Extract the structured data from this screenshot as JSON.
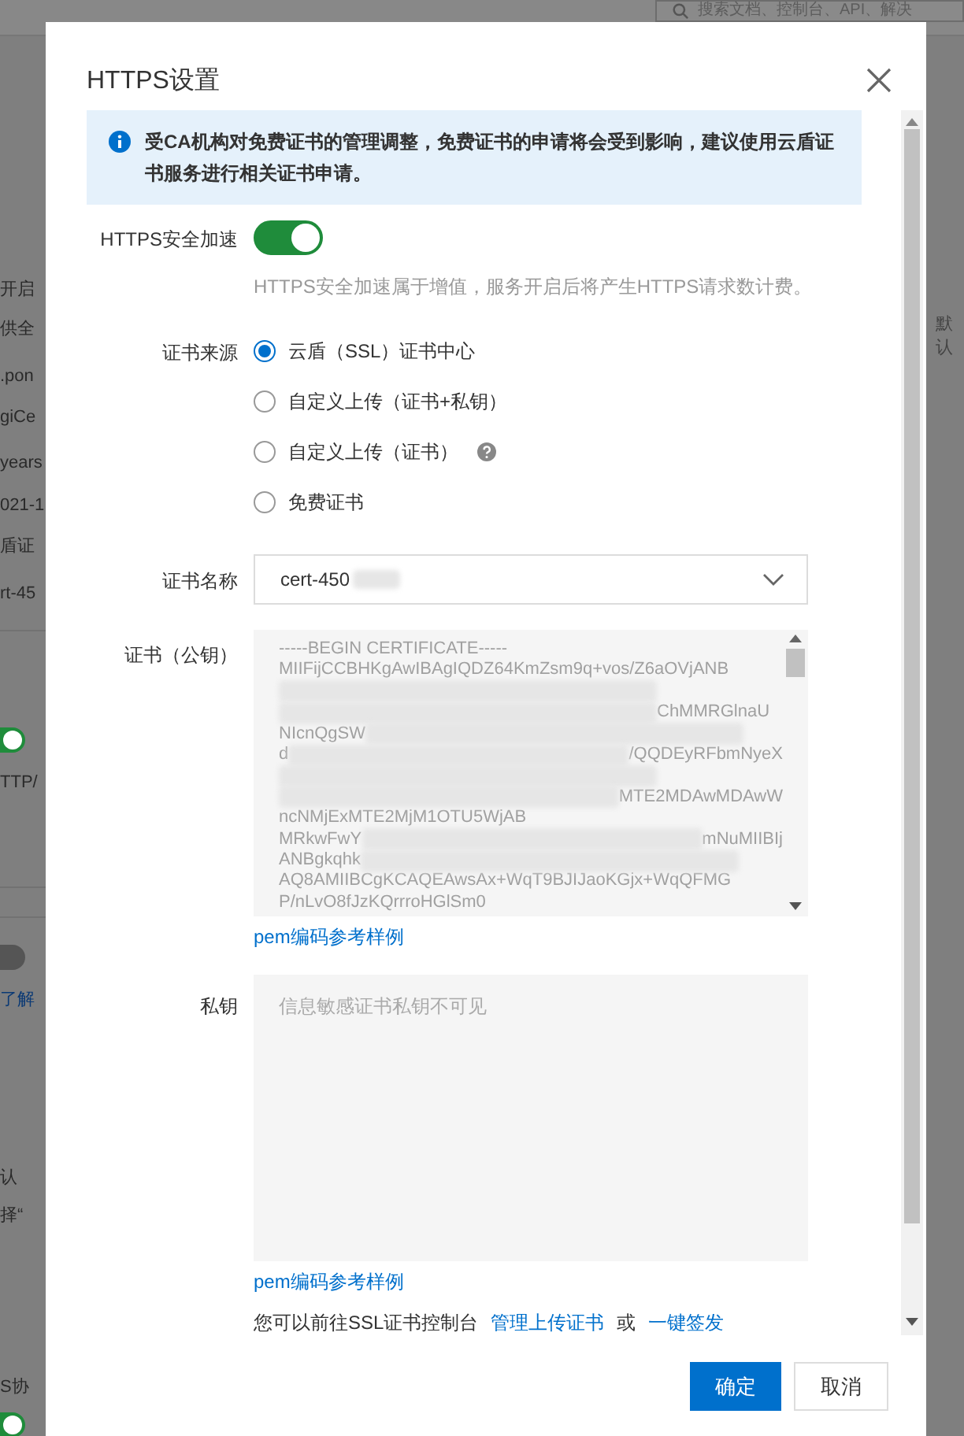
{
  "background": {
    "search": {
      "placeholder": "搜索文档、控制台、API、解决"
    },
    "left_fragments": [
      {
        "kind": "text",
        "text": "开启"
      },
      {
        "kind": "text",
        "text": "供全"
      },
      {
        "kind": "text",
        "text": ".pon"
      },
      {
        "kind": "text",
        "text": "giCe"
      },
      {
        "kind": "text",
        "text": "years"
      },
      {
        "kind": "text",
        "text": "021-1"
      },
      {
        "kind": "text",
        "text": "盾证"
      },
      {
        "kind": "text",
        "text": "rt-45"
      },
      {
        "kind": "switch",
        "on": true
      },
      {
        "kind": "text",
        "text": "TTP/"
      },
      {
        "kind": "switch",
        "on": false
      },
      {
        "kind": "link",
        "text": "了解"
      },
      {
        "kind": "text",
        "text": "认"
      },
      {
        "kind": "text",
        "text": "择“"
      },
      {
        "kind": "text",
        "text": "S协"
      },
      {
        "kind": "switch",
        "on": true
      }
    ],
    "right_fragments": [
      {
        "text": "默认"
      }
    ]
  },
  "dialog": {
    "title": "HTTPS设置",
    "notice": "受CA机构对免费证书的管理调整，免费证书的申请将会受到影响，建议使用云盾证书服务进行相关证书申请。",
    "https_acceleration": {
      "label": "HTTPS安全加速",
      "on": true,
      "hint": "HTTPS安全加速属于增值，服务开启后将产生HTTPS请求数计费。"
    },
    "cert_source": {
      "label": "证书来源",
      "options": [
        {
          "label": "云盾（SSL）证书中心",
          "selected": true,
          "help": false
        },
        {
          "label": "自定义上传（证书+私钥）",
          "selected": false,
          "help": false
        },
        {
          "label": "自定义上传（证书）",
          "selected": false,
          "help": true
        },
        {
          "label": "免费证书",
          "selected": false,
          "help": false
        }
      ]
    },
    "cert_name": {
      "label": "证书名称",
      "value": "cert-450"
    },
    "public_key": {
      "label": "证书（公钥）",
      "link": "pem编码参考样例",
      "lines": [
        [
          {
            "kind": "text",
            "text": "-----BEGIN CERTIFICATE-----"
          }
        ],
        [
          {
            "kind": "text",
            "text": "MIIFijCCBHKgAwIBAgIQDZ64KmZsm9q+vos/Z6aOVjANB"
          }
        ],
        [
          {
            "kind": "blur"
          }
        ],
        [
          {
            "kind": "blur"
          },
          {
            "kind": "text",
            "text": "ChMMRGlnaU"
          }
        ],
        [
          {
            "kind": "text",
            "text": "NIcnQgSW"
          },
          {
            "kind": "blur"
          }
        ],
        [
          {
            "kind": "text",
            "text": "d"
          },
          {
            "kind": "blur"
          },
          {
            "kind": "text",
            "text": "/QQDEyRFbmNyeX"
          }
        ],
        [
          {
            "kind": "blur"
          }
        ],
        [
          {
            "kind": "blur"
          },
          {
            "kind": "text",
            "text": "MTE2MDAwMDAwW"
          }
        ],
        [
          {
            "kind": "text",
            "text": "ncNMjExMTE2MjM1OTU5WjAB"
          }
        ],
        [
          {
            "kind": "text",
            "text": "MRkwFwY"
          },
          {
            "kind": "blur"
          },
          {
            "kind": "text",
            "text": "mNuMIIBIj"
          }
        ],
        [
          {
            "kind": "text",
            "text": "ANBgkqhk"
          },
          {
            "kind": "blur"
          }
        ],
        [
          {
            "kind": "text",
            "text": "AQ8AMIIBCgKCAQEAwsAx+WqT9BJIJaoKGjx+WqQFMG"
          }
        ],
        [
          {
            "kind": "text",
            "text": "P/nLvO8fJzKQrrroHGlSm0"
          }
        ]
      ]
    },
    "private_key": {
      "label": "私钥",
      "placeholder": "信息敏感证书私钥不可见",
      "link": "pem编码参考样例"
    },
    "footer_note": {
      "text": "您可以前往SSL证书控制台",
      "link_1": "管理上传证书",
      "separator": "或",
      "link_2": "一键签发"
    },
    "buttons": [
      {
        "label": "确定",
        "kind": "primary"
      },
      {
        "label": "取消",
        "kind": "default"
      }
    ]
  }
}
